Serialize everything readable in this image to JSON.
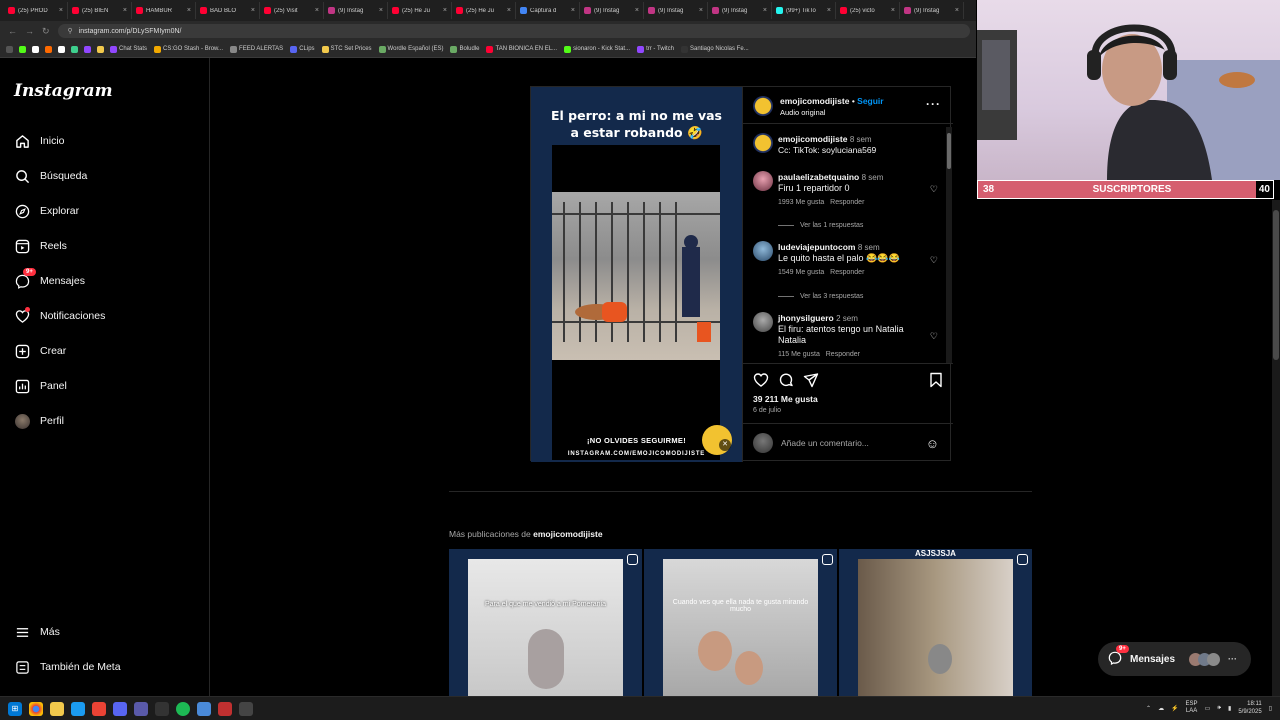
{
  "browser": {
    "tabs": [
      {
        "label": "(25) PROD",
        "color": "#ff0033"
      },
      {
        "label": "(25) BIEN",
        "color": "#ff0033"
      },
      {
        "label": "HAMBUR",
        "color": "#ff0033"
      },
      {
        "label": "BAD BLO",
        "color": "#ff0033"
      },
      {
        "label": "(25) Visit",
        "color": "#ff0033"
      },
      {
        "label": "(9) Instag",
        "color": "#c13584"
      },
      {
        "label": "(25) He Ju",
        "color": "#ff0033"
      },
      {
        "label": "(25) He Ju",
        "color": "#ff0033"
      },
      {
        "label": "Captura d",
        "color": "#4285f4"
      },
      {
        "label": "(9) Instag",
        "color": "#c13584"
      },
      {
        "label": "(9) Instag",
        "color": "#c13584"
      },
      {
        "label": "(9) Instag",
        "color": "#c13584"
      },
      {
        "label": "(99+) TikTo",
        "color": "#25f4ee"
      },
      {
        "label": "(25) victo",
        "color": "#ff0033"
      },
      {
        "label": "(9) Instag",
        "color": "#c13584"
      }
    ],
    "url": "instagram.com/p/DLySFMIym0N/",
    "bookmarks": [
      {
        "label": "Chat Stats",
        "color": "#9147ff"
      },
      {
        "label": "CS:GO Stash - Brow...",
        "color": "#f2a900"
      },
      {
        "label": "FEED ALERTAS",
        "color": "#888888"
      },
      {
        "label": "CLips",
        "color": "#5865f2"
      },
      {
        "label": "STC Set Prices",
        "color": "#f2c94c"
      },
      {
        "label": "Wordle Español (ES)",
        "color": "#6aaa64"
      },
      {
        "label": "Boludle",
        "color": "#6aaa64"
      },
      {
        "label": "TAN BIONICA EN EL...",
        "color": "#ff0033"
      },
      {
        "label": "sionaron - Kick Stat...",
        "color": "#53fc18"
      },
      {
        "label": "trr - Twitch",
        "color": "#9147ff"
      },
      {
        "label": "Santiago Nicolas Fe...",
        "color": "#333333"
      }
    ]
  },
  "sidebar": {
    "logo": "Instagram",
    "items": [
      {
        "label": "Inicio",
        "icon": "home-icon"
      },
      {
        "label": "Búsqueda",
        "icon": "search-icon"
      },
      {
        "label": "Explorar",
        "icon": "compass-icon"
      },
      {
        "label": "Reels",
        "icon": "reels-icon"
      },
      {
        "label": "Mensajes",
        "icon": "messenger-icon",
        "badge": "9+"
      },
      {
        "label": "Notificaciones",
        "icon": "heart-icon"
      },
      {
        "label": "Crear",
        "icon": "plus-icon"
      },
      {
        "label": "Panel",
        "icon": "chart-icon"
      },
      {
        "label": "Perfil",
        "icon": "avatar-icon"
      }
    ],
    "more": "Más",
    "meta": "También de Meta"
  },
  "post": {
    "caption_line1": "El perro: a mi no me vas",
    "caption_line2": "a estar robando 🤣",
    "footer_line1": "¡NO OLVIDES SEGUIRME!",
    "footer_line2": "INSTAGRAM.COM/EMOJICOMODIJISTE",
    "author": "emojicomodijiste",
    "follow": "Seguir",
    "audio": "Audio original",
    "author_caption_age": "8 sem",
    "author_caption": "Cc: TikTok: soyluciana569",
    "comments": [
      {
        "user": "paulaelizabetquaino",
        "age": "8 sem",
        "text": "Firu 1 repartidor 0",
        "likes": "1993 Me gusta",
        "reply": "Responder",
        "replies": "Ver las 1 respuestas"
      },
      {
        "user": "ludeviajepuntocom",
        "age": "8 sem",
        "text": "Le quito hasta el palo 😂😂😂",
        "likes": "1549 Me gusta",
        "reply": "Responder",
        "replies": "Ver las 3 respuestas"
      },
      {
        "user": "jhonysilguero",
        "age": "2 sem",
        "text": "El firu: atentos tengo un Natalia Natalia",
        "likes": "115 Me gusta",
        "reply": "Responder"
      }
    ],
    "likes": "39 211 Me gusta",
    "date": "6 de julio",
    "add_comment_placeholder": "Añade un comentario..."
  },
  "more_posts": {
    "prefix": "Más publicaciones de",
    "author": "emojicomodijiste",
    "thumbs": [
      {
        "text": "Para el que me vendió a mi Pomerania"
      },
      {
        "text": "Cuando ves que ella nada te gusta mirando mucho"
      },
      {
        "text": "ASJSJSJA"
      }
    ]
  },
  "messages_pill": {
    "label": "Mensajes",
    "badge": "9+"
  },
  "stream": {
    "sub_current": "38",
    "sub_label": "SUSCRIPTORES",
    "sub_goal": "40"
  },
  "taskbar": {
    "lang1": "ESP",
    "lang2": "LAA",
    "time": "18:11",
    "date": "5/9/2025"
  }
}
